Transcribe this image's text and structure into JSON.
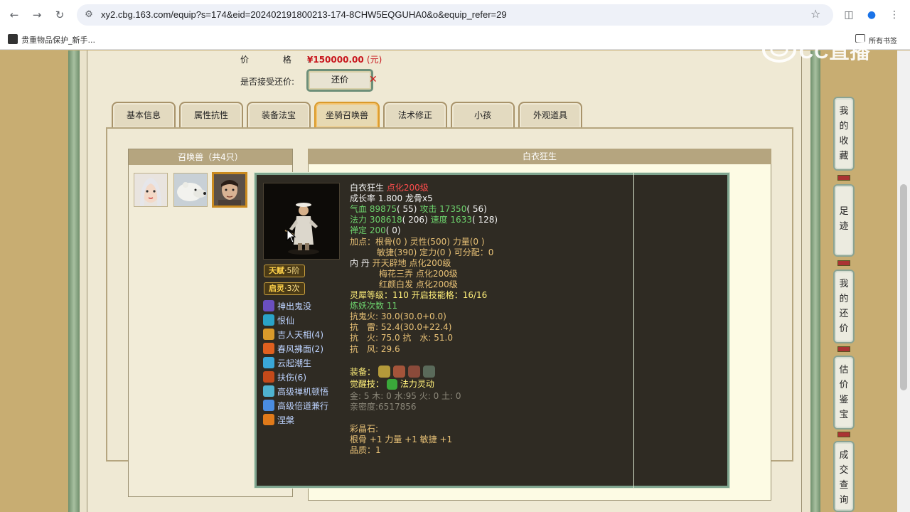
{
  "browser": {
    "url": "xy2.cbg.163.com/equip?s=174&eid=202402191800213-174-8CHW5EQGUHA0&o&equip_refer=29",
    "bookmark_label": "贵重物品保护_新手...",
    "all_bookmarks_label": "所有书签"
  },
  "watermark": "CC直播",
  "price_row": {
    "label": "价 格:",
    "value": "¥150000.00",
    "unit": "(元)"
  },
  "haggle": {
    "label": "是否接受还价:",
    "button_label": "还价",
    "mark": "✕"
  },
  "tabs": [
    {
      "label": "基本信息",
      "active": false
    },
    {
      "label": "属性抗性",
      "active": false
    },
    {
      "label": "装备法宝",
      "active": false
    },
    {
      "label": "坐骑召唤兽",
      "active": true
    },
    {
      "label": "法术修正",
      "active": false
    },
    {
      "label": "小孩",
      "active": false
    },
    {
      "label": "外观道具",
      "active": false
    }
  ],
  "pets_panel": {
    "title": "召唤兽（共4只）"
  },
  "info_panel": {
    "title": "白衣狂生"
  },
  "tooltip": {
    "name": "白衣狂生",
    "level_tag": "点化200级",
    "growth": "成长率 1.800 龙骨x5",
    "hp_label": "气血",
    "hp_value": "89875",
    "hp_point": "( 55)",
    "atk_label": "攻击",
    "atk_value": "17350",
    "atk_point": "( 56)",
    "mp_label": "法力",
    "mp_value": "308618",
    "mp_point": "( 206)",
    "spd_label": "速度",
    "spd_value": "1633",
    "spd_point": "( 128)",
    "ding_label": "禅定",
    "ding_value": "200",
    "ding_point": "( 0)",
    "addpoint_1": "加点：根骨(0 ) 灵性(500) 力量(0 )",
    "addpoint_2": "敏捷(390) 定力(0 ) 可分配：0",
    "dan_label": "内 丹",
    "dan_1": "开天辟地 点化200级",
    "dan_2": "梅花三弄 点化200级",
    "dan_3": "红颜白发 点化200级",
    "lingxi": "灵犀等级：110 开启技能格：16/16",
    "lianyao": "炼妖次数 11",
    "resist_ghost": "抗鬼火: 30.0(30.0+0.0)",
    "resist_thunder": "抗　雷: 52.4(30.0+22.4)",
    "resist_fire_water": "抗　火: 75.0 抗　水: 51.0",
    "resist_wind": "抗　风: 29.6",
    "equip_label": "装备：",
    "awaken_label": "觉醒技：",
    "awaken_skill": "法力灵动",
    "elements": "金: 5 木: 0 水:95 火: 0 土: 0",
    "intimacy": "亲密度:6517856",
    "crystal_label": "彩晶石:",
    "crystal_attr": "根骨 +1 力量 +1 敏捷 +1",
    "crystal_quality": "品质：1"
  },
  "badges": [
    {
      "label": "天赋",
      "value": "·5阶"
    },
    {
      "label": "启灵",
      "value": "·3次"
    }
  ],
  "skills": [
    {
      "label": "神出鬼没",
      "color": "#6a4fc0"
    },
    {
      "label": "恨仙",
      "color": "#2aa3c8"
    },
    {
      "label": "吉人天相(4)",
      "color": "#d99a2b"
    },
    {
      "label": "春风拂面(2)",
      "color": "#e0601f"
    },
    {
      "label": "云起潮生",
      "color": "#3aa7d8"
    },
    {
      "label": "扶伤(6)",
      "color": "#c44a1a"
    },
    {
      "label": "高级禅机顿悟",
      "color": "#4fb3d0"
    },
    {
      "label": "高级倍道兼行",
      "color": "#4a8ce0"
    },
    {
      "label": "涅槃",
      "color": "#e07a1a"
    }
  ],
  "side_nav": [
    {
      "label": "我的收藏",
      "chars": [
        "我",
        "的",
        "收",
        "藏"
      ]
    },
    {
      "label": "足迹",
      "chars": [
        "足",
        "迹"
      ]
    },
    {
      "label": "我的还价",
      "chars": [
        "我",
        "的",
        "还",
        "价"
      ]
    },
    {
      "label": "估价鉴宝",
      "chars": [
        "估",
        "价",
        "鉴",
        "宝"
      ]
    },
    {
      "label": "成交查询",
      "chars": [
        "成",
        "交",
        "查",
        "询"
      ]
    }
  ]
}
